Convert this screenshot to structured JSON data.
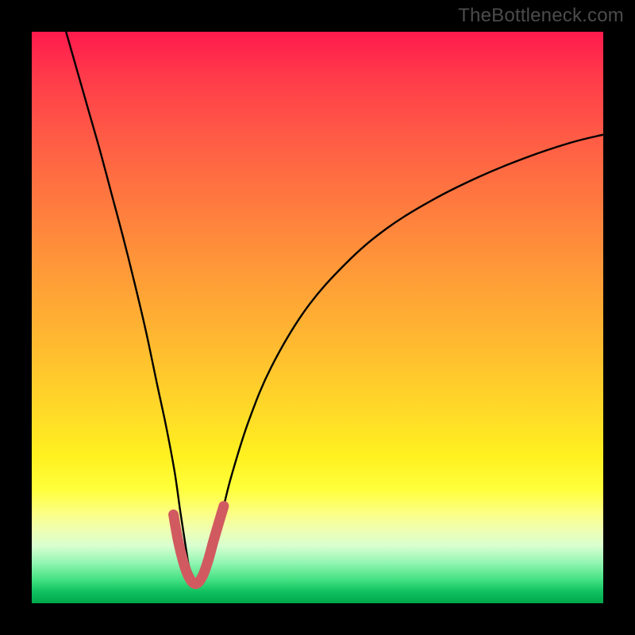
{
  "watermark": "TheBottleneck.com",
  "chart_data": {
    "type": "line",
    "title": "",
    "xlabel": "",
    "ylabel": "",
    "xlim": [
      0,
      100
    ],
    "ylim": [
      0,
      100
    ],
    "series": [
      {
        "name": "black-curve",
        "stroke": "#000000",
        "stroke_width": 2.4,
        "x": [
          6,
          8,
          10,
          12,
          14,
          16,
          18,
          20,
          22,
          23.5,
          25,
          26,
          27,
          27.6,
          28.8,
          30,
          31,
          32,
          33.5,
          35,
          38,
          42,
          48,
          55,
          62,
          70,
          78,
          86,
          94,
          100
        ],
        "y": [
          100,
          93,
          86,
          79,
          71.5,
          64,
          56,
          47.5,
          38,
          31,
          23,
          16,
          9.5,
          6.2,
          3.6,
          3.6,
          6.6,
          10.5,
          16.6,
          22.5,
          32,
          41.5,
          51.5,
          59.5,
          65.5,
          70.5,
          74.5,
          77.8,
          80.5,
          82
        ]
      },
      {
        "name": "red-highlight",
        "stroke": "#d15a60",
        "stroke_width": 13,
        "linecap": "round",
        "x": [
          24.8,
          25.6,
          26.5,
          27.3,
          28.2,
          29.1,
          30.0,
          30.9,
          31.8,
          32.7,
          33.6
        ],
        "y": [
          15.5,
          11.0,
          7.3,
          5.0,
          3.6,
          3.6,
          5.0,
          7.6,
          10.9,
          14.0,
          17.0
        ]
      }
    ],
    "background_gradient_stops": [
      {
        "pct": 0,
        "color": "#ff1a4d"
      },
      {
        "pct": 8,
        "color": "#ff3b4a"
      },
      {
        "pct": 18,
        "color": "#ff5a46"
      },
      {
        "pct": 30,
        "color": "#ff7a3f"
      },
      {
        "pct": 42,
        "color": "#ff9a38"
      },
      {
        "pct": 55,
        "color": "#ffbb30"
      },
      {
        "pct": 66,
        "color": "#ffd928"
      },
      {
        "pct": 74,
        "color": "#fff020"
      },
      {
        "pct": 80,
        "color": "#ffff3a"
      },
      {
        "pct": 84,
        "color": "#fcff80"
      },
      {
        "pct": 87,
        "color": "#f0ffb0"
      },
      {
        "pct": 90,
        "color": "#d8ffd0"
      },
      {
        "pct": 93,
        "color": "#90f5b0"
      },
      {
        "pct": 96,
        "color": "#40e080"
      },
      {
        "pct": 98,
        "color": "#10c060"
      },
      {
        "pct": 100,
        "color": "#00a84a"
      }
    ]
  }
}
